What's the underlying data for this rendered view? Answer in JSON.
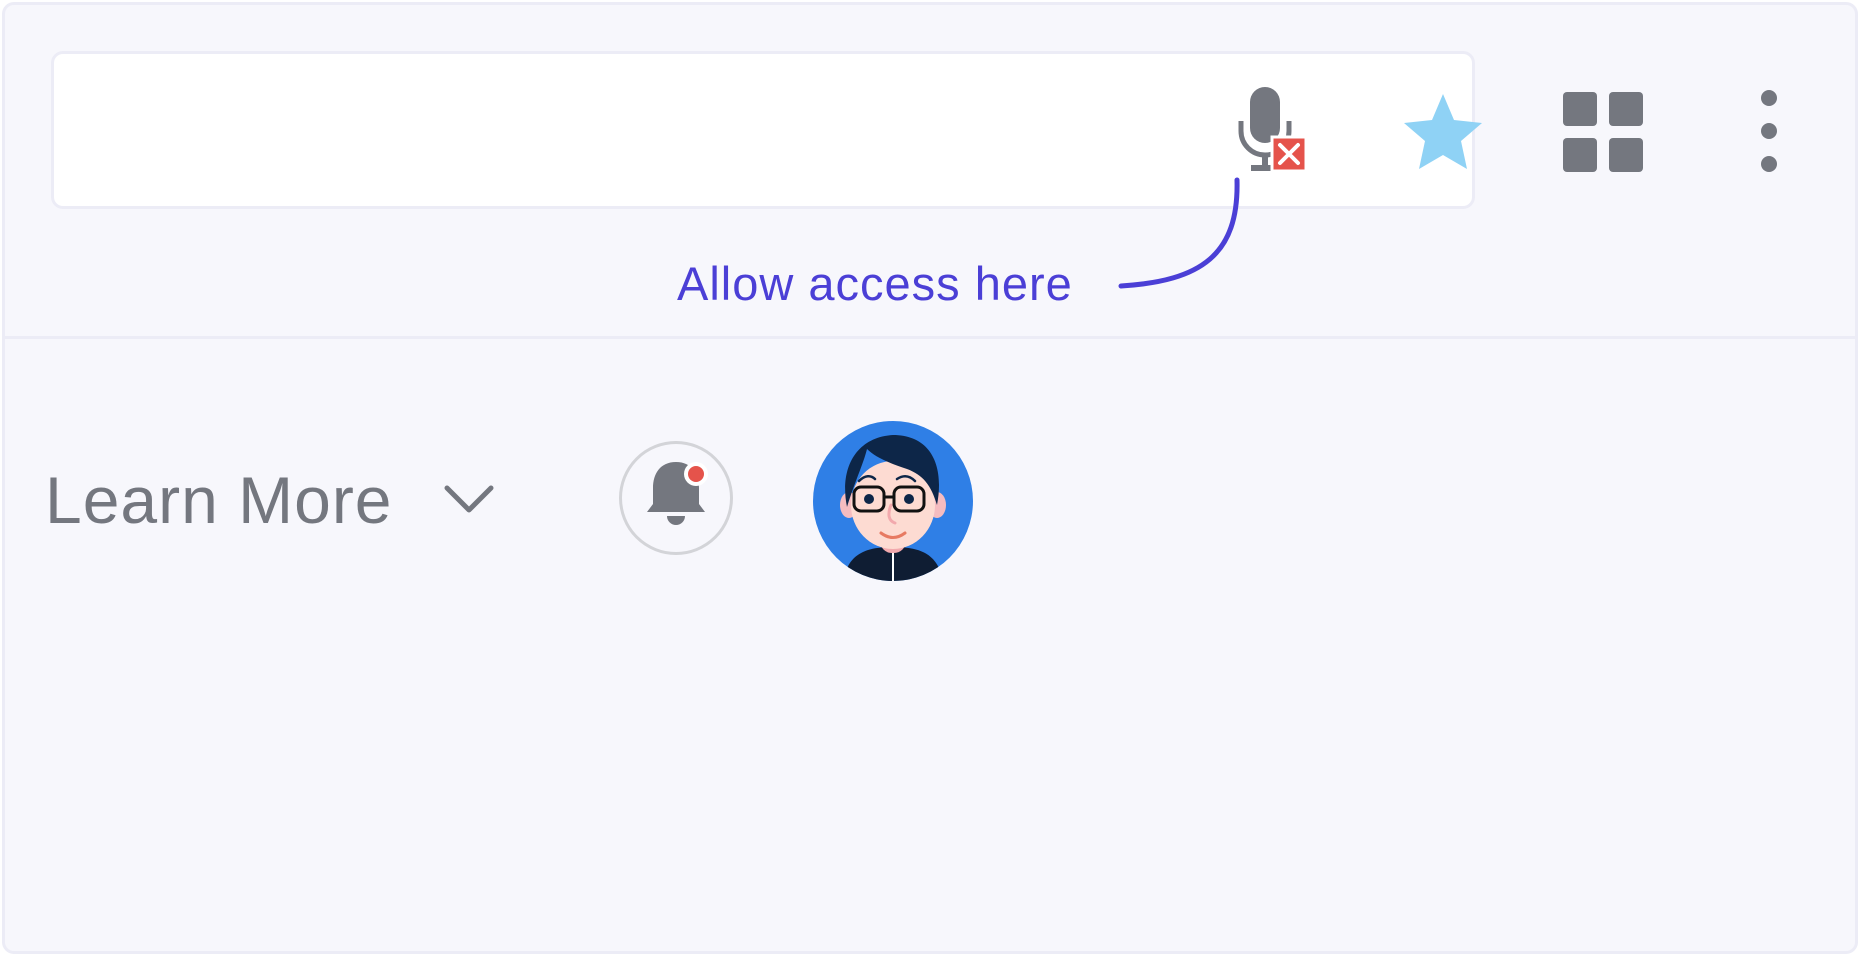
{
  "toolbar": {
    "mic_icon": "microphone-blocked-icon",
    "star_icon": "star-icon",
    "apps_icon": "apps-grid-icon",
    "more_icon": "more-vertical-icon"
  },
  "hint": {
    "text": "Allow access here"
  },
  "content": {
    "learn_more_label": "Learn More",
    "chevron_icon": "chevron-down-icon",
    "bell_icon": "bell-icon",
    "avatar": "avatar"
  },
  "colors": {
    "accent": "#4b3fd6",
    "icon_gray": "#74777f",
    "blocked_red": "#e5534b",
    "star_blue": "#8fd2f5",
    "avatar_bg": "#2f7fe6",
    "background": "#f7f7fc"
  }
}
